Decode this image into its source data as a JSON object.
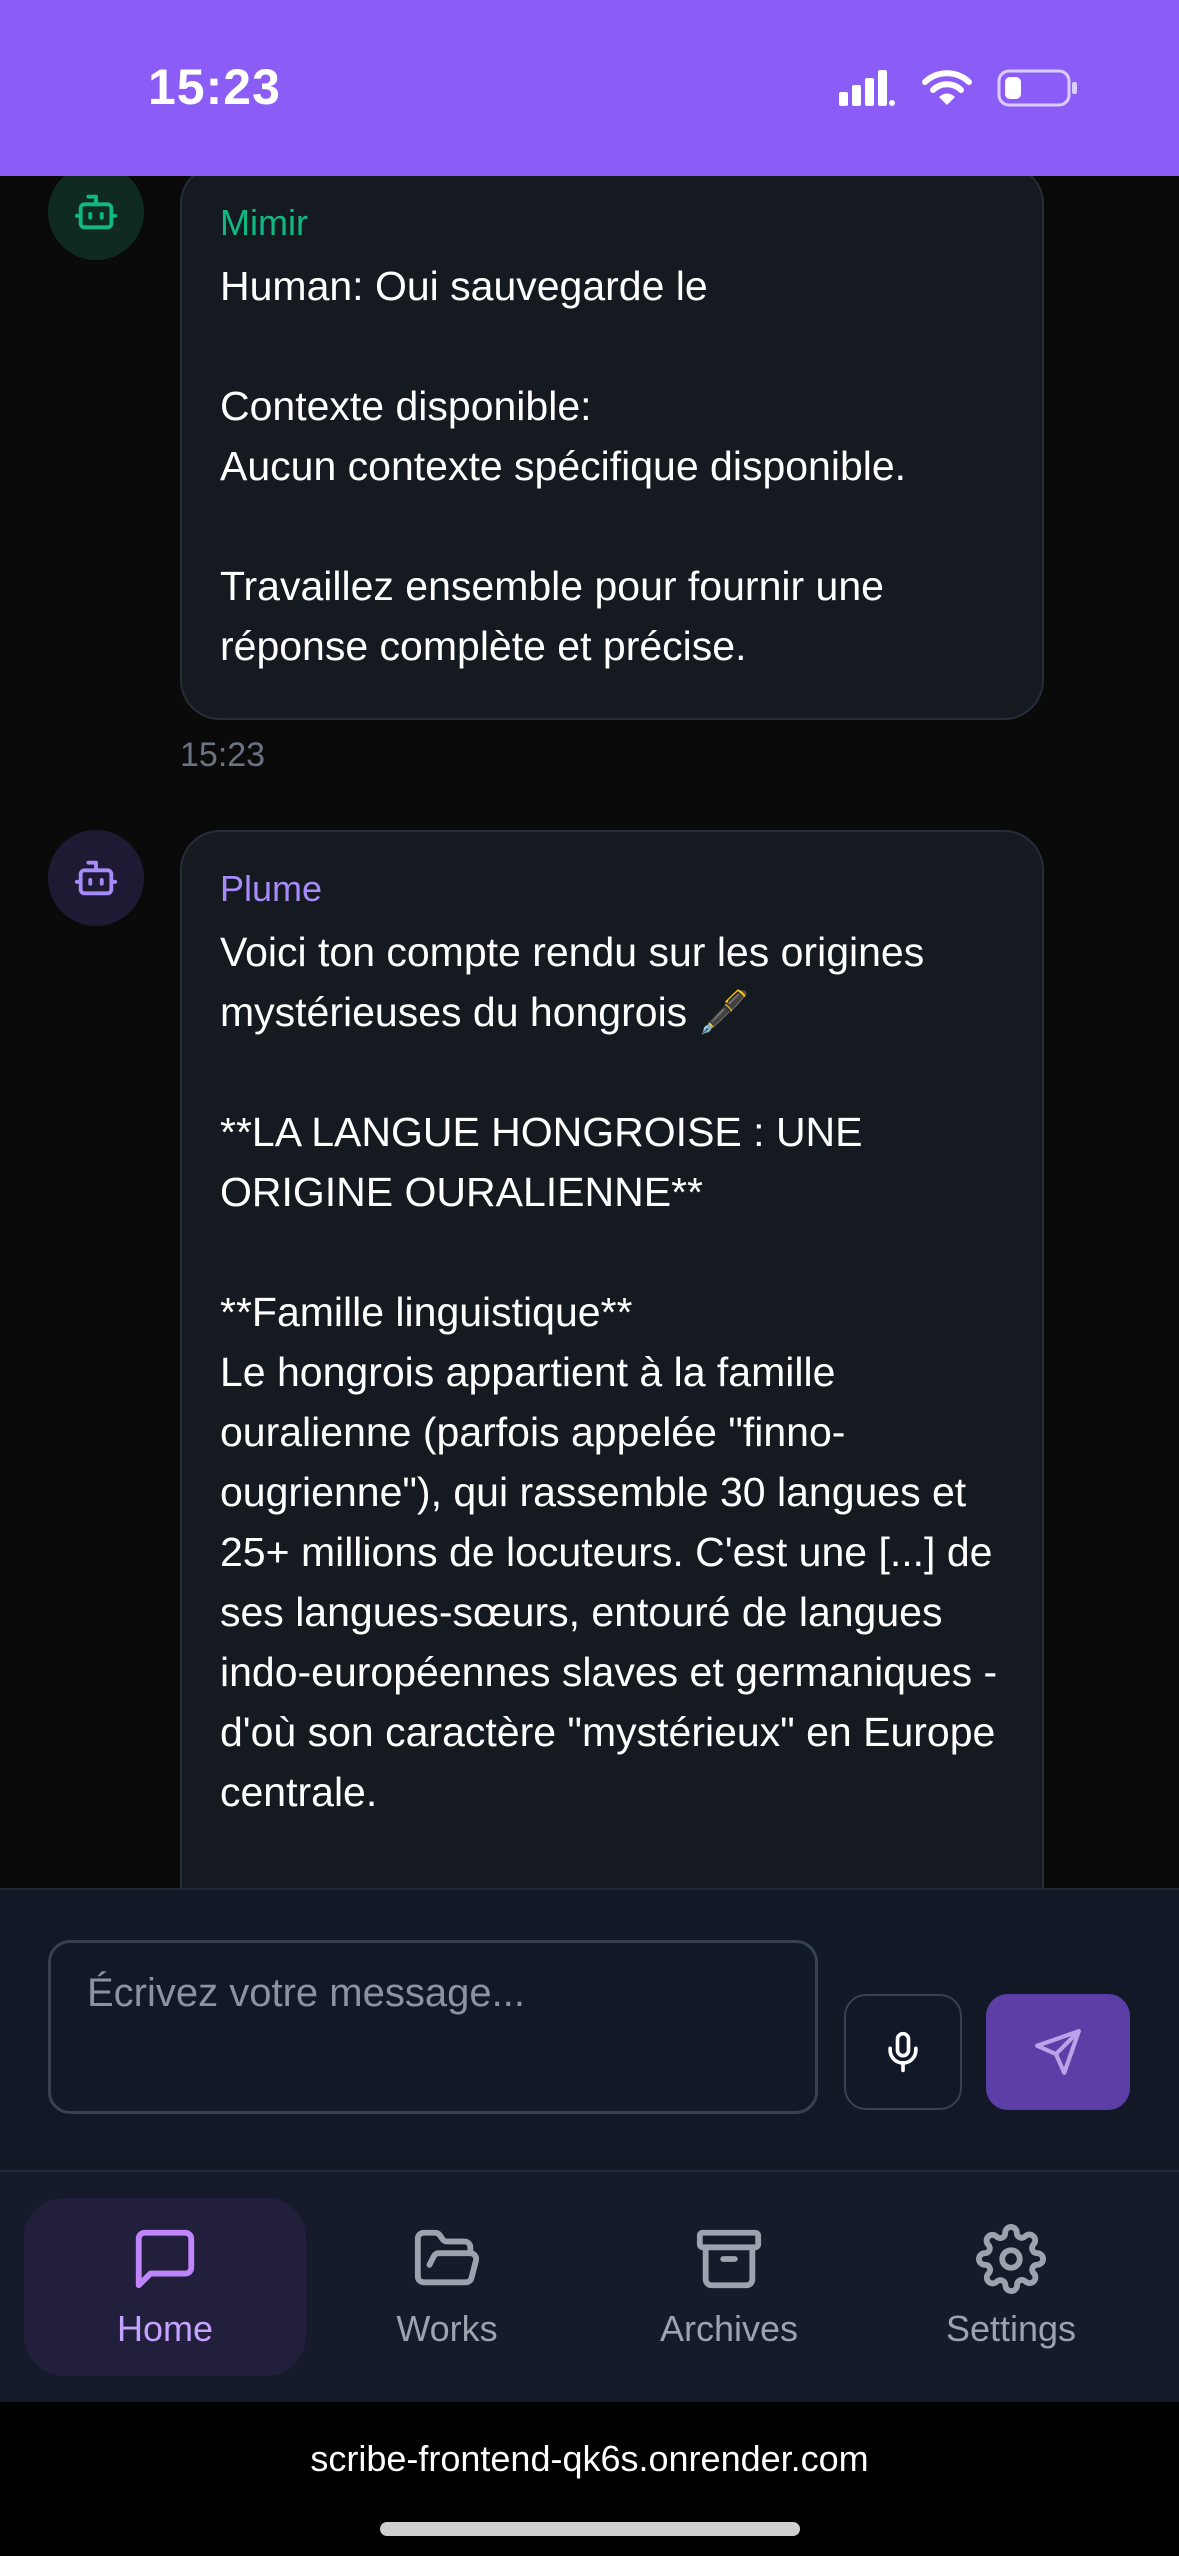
{
  "status_bar": {
    "time": "15:23",
    "icons": [
      "signal-icon",
      "wifi-icon",
      "battery-icon"
    ]
  },
  "messages": [
    {
      "sender": "Mimir",
      "text": "Human: Oui sauvegarde le\n\nContexte disponible:\nAucun contexte spécifique disponible.\n\nTravaillez ensemble pour fournir une réponse complète et précise.",
      "time": "15:23",
      "icon": "robot-icon"
    },
    {
      "sender": "Plume",
      "text": "Voici ton compte rendu sur les origines mystérieuses du hongrois 🖋️\n\n**LA LANGUE HONGROISE : UNE ORIGINE OURALIENNE**\n\n**Famille linguistique**\nLe hongrois appartient à la famille ouralienne (parfois appelée \"finno-ougrienne\"), qui rassemble 30 langues et 25+ millions de locuteurs. C'est une [...] de ses langues-sœurs, entouré de langues indo-européennes slaves et germaniques - d'où son caractère \"mystérieux\" en Europe centrale.",
      "icon": "robot-icon"
    }
  ],
  "composer": {
    "placeholder": "Écrivez votre message...",
    "mic_icon": "microphone-icon",
    "send_icon": "send-icon"
  },
  "nav": {
    "items": [
      {
        "label": "Home",
        "icon": "chat-bubble-icon",
        "active": true
      },
      {
        "label": "Works",
        "icon": "folder-open-icon",
        "active": false
      },
      {
        "label": "Archives",
        "icon": "archive-icon",
        "active": false
      },
      {
        "label": "Settings",
        "icon": "gear-icon",
        "active": false
      }
    ]
  },
  "browser": {
    "url": "scribe-frontend-qk6s.onrender.com"
  },
  "colors": {
    "accent": "#8b5cf6",
    "mimir": "#10b981",
    "plume": "#a78bfa",
    "background": "#0a0a0b"
  }
}
